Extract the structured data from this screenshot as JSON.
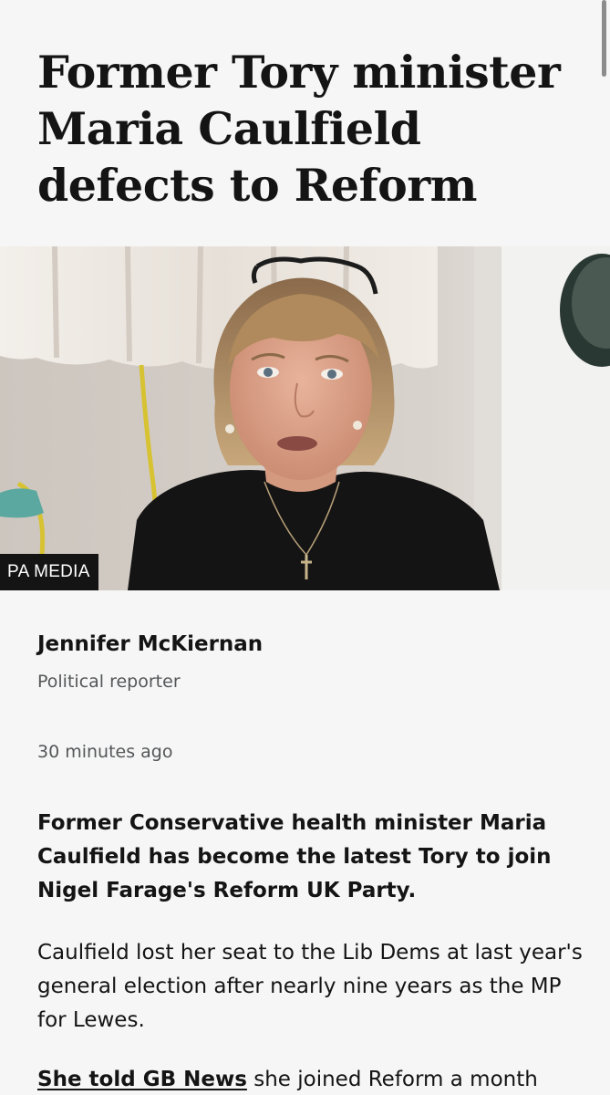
{
  "article": {
    "headline": "Former Tory minister Maria Caulfield defects to Reform",
    "image": {
      "credit": "PA MEDIA"
    },
    "byline": {
      "author": "Jennifer McKiernan",
      "role": "Political reporter"
    },
    "timestamp": "30 minutes ago",
    "lead": "Former Conservative health minister Maria Caulfield has become the latest Tory to join Nigel Farage's Reform UK Party.",
    "paragraphs": [
      "Caulfield lost her seat to the Lib Dems at last year's general election after nearly nine years as the MP for Lewes."
    ],
    "partial_paragraph": {
      "link_text": "She told GB News",
      "text": " she joined Reform a month"
    }
  },
  "colors": {
    "background": "#f6f6f6",
    "text": "#141414",
    "secondary_text": "#545658",
    "credit_background": "#141414"
  }
}
